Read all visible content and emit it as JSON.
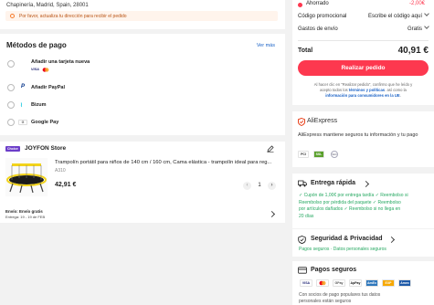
{
  "address": {
    "text": "Chapinería, Madrid, Spain, 28001"
  },
  "notice": {
    "text": "Por favor, actualiza tu dirección para recibir el pedido"
  },
  "payment": {
    "title": "Métodos de pago",
    "see_more": "Ver más",
    "methods": [
      {
        "label": "Añadir una tarjeta nueva"
      },
      {
        "label": "Añadir PayPal"
      },
      {
        "label": "Bizum"
      },
      {
        "label": "Google Pay"
      }
    ],
    "card_logos": [
      "VISA",
      "MC"
    ]
  },
  "store": {
    "badge": "Choice",
    "name": "JOYFON Store",
    "product": {
      "title": "Trampolín portátil para niños de 140 cm / 160 cm, Cama elástica - trampolín ideal para reg...",
      "variant": "A310",
      "price": "42,91 €",
      "quantity": "1"
    },
    "shipping_title": "Envío: Envío gratis",
    "shipping_date": "Entrega: 19 - 19 de FEB"
  },
  "summary": {
    "savings_label": "Ahorrado",
    "savings_value": "-2,00€",
    "promo_label": "Código promocional",
    "promo_value": "Escribe el código aquí",
    "shipping_label": "Gastos de envío",
    "shipping_value": "Gratis",
    "total_label": "Total",
    "total_value": "40,91 €",
    "button": "Realizar pedido",
    "legal_1": "Al hacer clic en \"Realizar pedido\", confirmo que he leído y",
    "legal_2": "acepto todos los",
    "legal_link1": "términos y políticas",
    "legal_3": ". así como la",
    "legal_link2": "información para consumidores en la UE",
    "legal_4": "."
  },
  "trust": {
    "brand": "AliExpress",
    "text": "AliExpress mantiene seguros tu información y tu pago",
    "logos": [
      "PCI",
      "SSL",
      "SEC"
    ]
  },
  "delivery": {
    "title": "Entrega rápida",
    "items": [
      "✓ Cupón de 1,00€ por entrega tardía  ✓ Reembolso si",
      "Reembolso por pérdida del paquete  ✓ Reembolso",
      "por artículos dañados  ✓ Reembolso si no llega en",
      "20 días"
    ]
  },
  "security": {
    "title": "Seguridad & Privacidad",
    "text": "Pagos seguros · Datos personales seguros"
  },
  "secure_payments": {
    "title": "Pagos seguros",
    "logos": [
      "VISA",
      "MC",
      "GPay",
      "ApPay",
      "AmEx",
      "EXP",
      "Amex"
    ],
    "text_1": "Con socios de pago populares tus datos",
    "text_2": "personales están seguros"
  },
  "colors": {
    "accent": "#fd384f",
    "link": "#1a62c6",
    "green": "#26a861"
  }
}
